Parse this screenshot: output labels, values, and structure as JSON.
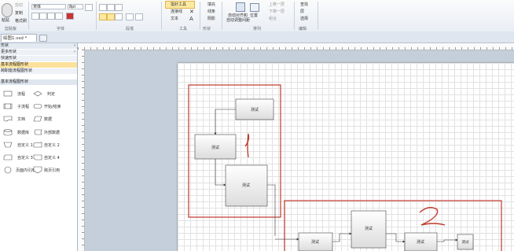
{
  "ribbon": {
    "clipboard": {
      "paste_label": "粘贴",
      "cut_label": "剪切",
      "copy_label": "复制",
      "format_painter_label": "格式刷",
      "group_label": "剪贴板"
    },
    "font": {
      "font_name": "宋体",
      "font_size": "8pt",
      "group_label": "字体"
    },
    "paragraph": {
      "group_label": "段落"
    },
    "tools": {
      "pointer_label": "指针工具",
      "connector_label": "连接线",
      "text_label": "文本",
      "group_label": "工具"
    },
    "shape": {
      "fill_label": "填充",
      "line_label": "线条",
      "shadow_label": "阴影",
      "group_label": "形状"
    },
    "arrange": {
      "autoalign_label": "自动对齐和",
      "autospace_label": "自动调整间距",
      "position_label": "位置",
      "bring_front_label": "上移一层",
      "send_back_label": "下移一层",
      "group_shapes_label": "组合",
      "group_label": "排列"
    },
    "editing": {
      "find_label": "查找",
      "layers_label": "层",
      "select_label": "选择",
      "group_label": "编辑"
    }
  },
  "document_tab": {
    "label": "绘图1.vsd *"
  },
  "shapes_panel": {
    "title": "形状",
    "rows": [
      "更多形状",
      "快速形状",
      "基本流程图形状",
      "跨职能流程图形状"
    ],
    "stencil_title": "基本流程图形状",
    "items": [
      [
        "流程",
        "判定"
      ],
      [
        "子流程",
        "开始/结束"
      ],
      [
        "文档",
        "数据"
      ],
      [
        "数据库",
        "外部数据"
      ],
      [
        "自定义 1",
        "自定义 2"
      ],
      [
        "自定义 3",
        "自定义 4"
      ],
      [
        "页面内引用",
        "跨页引用"
      ]
    ]
  },
  "diagram": {
    "shape_text": "测试",
    "annotation_1": "1",
    "annotation_2": "2"
  }
}
